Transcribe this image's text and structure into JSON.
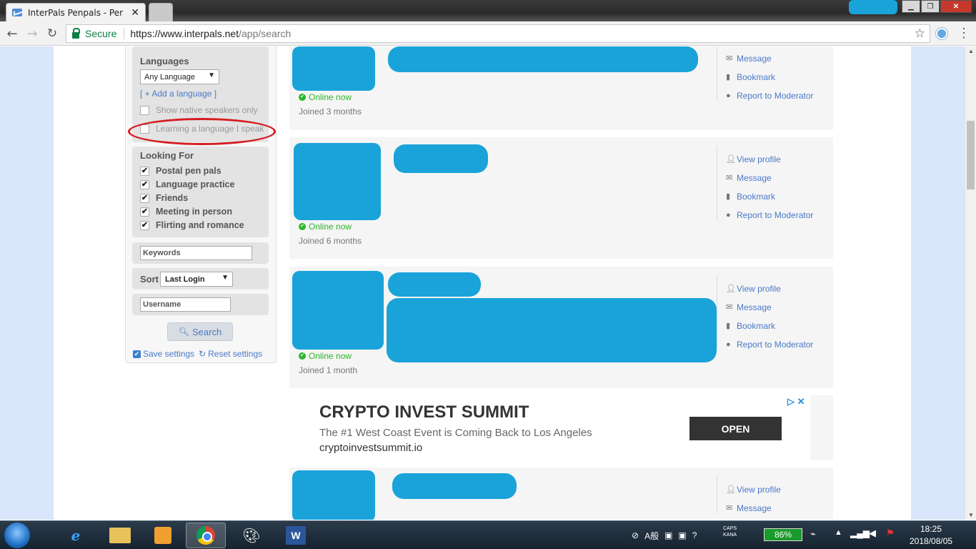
{
  "browser": {
    "tab_title": "InterPals Penpals - Per",
    "tab_close": "✕",
    "secure_label": "Secure",
    "url_host": "https://www.interpals.net",
    "url_path": "/app/search"
  },
  "sidebar": {
    "languages_title": "Languages",
    "language_select": "Any Language",
    "add_language": "[ + Add a language ]",
    "native_only": "Show native speakers only",
    "learning_my_language": "Learning a language I speak",
    "looking_for_title": "Looking For",
    "looking_for": [
      {
        "label": "Postal pen pals",
        "checked": true
      },
      {
        "label": "Language practice",
        "checked": true
      },
      {
        "label": "Friends",
        "checked": true
      },
      {
        "label": "Meeting in person",
        "checked": true
      },
      {
        "label": "Flirting and romance",
        "checked": true
      }
    ],
    "keywords_placeholder": "Keywords",
    "sort_label": "Sort",
    "sort_value": "Last Login",
    "username_placeholder": "Username",
    "search_button": "Search",
    "save_settings": "Save settings",
    "reset_settings": "Reset settings"
  },
  "results": [
    {
      "status": "Online now",
      "joined": "Joined 3 months",
      "actions": [
        "Message",
        "Bookmark",
        "Report to Moderator"
      ]
    },
    {
      "status": "Online now",
      "joined": "Joined 6 months",
      "actions": [
        "View profile",
        "Message",
        "Bookmark",
        "Report to Moderator"
      ]
    },
    {
      "status": "Online now",
      "joined": "Joined 1 month",
      "actions": [
        "View profile",
        "Message",
        "Bookmark",
        "Report to Moderator"
      ]
    },
    {
      "status": "",
      "joined": "",
      "actions": [
        "View profile",
        "Message"
      ]
    }
  ],
  "ad": {
    "title": "CRYPTO INVEST SUMMIT",
    "subtitle": "The #1 West Coast Event is Coming Back to Los Angeles",
    "domain": "cryptoinvestsummit.io",
    "button": "OPEN"
  },
  "taskbar": {
    "battery": "86%",
    "caps": "CAPS",
    "kana": "KANA",
    "ime": "A般",
    "time": "18:25",
    "date": "2018/08/05"
  },
  "colors": {
    "accent_link": "#4a79c9",
    "online_green": "#2bb52b",
    "redaction_blue": "#1aa3d9",
    "annotation_red": "#d51d22"
  }
}
